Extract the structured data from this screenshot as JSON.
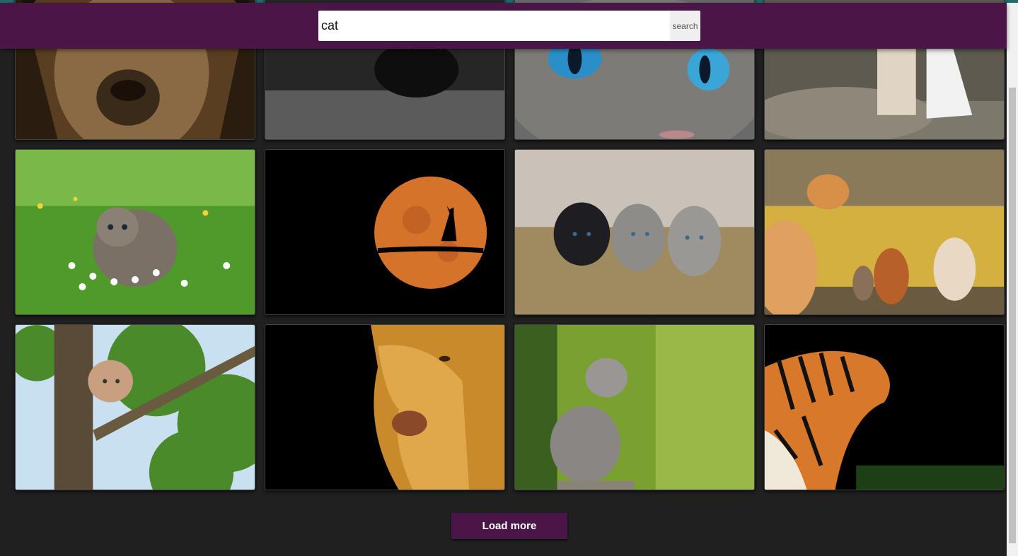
{
  "search": {
    "value": "cat",
    "button_label": "search"
  },
  "gallery": {
    "images": [
      {
        "subject": "lion-face"
      },
      {
        "subject": "black-cat"
      },
      {
        "subject": "blue-eyed-cat"
      },
      {
        "subject": "cat-with-woman"
      },
      {
        "subject": "kitten-in-daisies"
      },
      {
        "subject": "cat-silhouette-moon"
      },
      {
        "subject": "three-kittens-in-straw"
      },
      {
        "subject": "cats-and-dogs"
      },
      {
        "subject": "kitten-in-tree"
      },
      {
        "subject": "lion-profile"
      },
      {
        "subject": "kitten-in-grass"
      },
      {
        "subject": "tiger"
      }
    ]
  },
  "load_more_label": "Load more",
  "colors": {
    "header": "#4a1648",
    "background": "#202020",
    "accent_top": "#1f6f6f"
  }
}
